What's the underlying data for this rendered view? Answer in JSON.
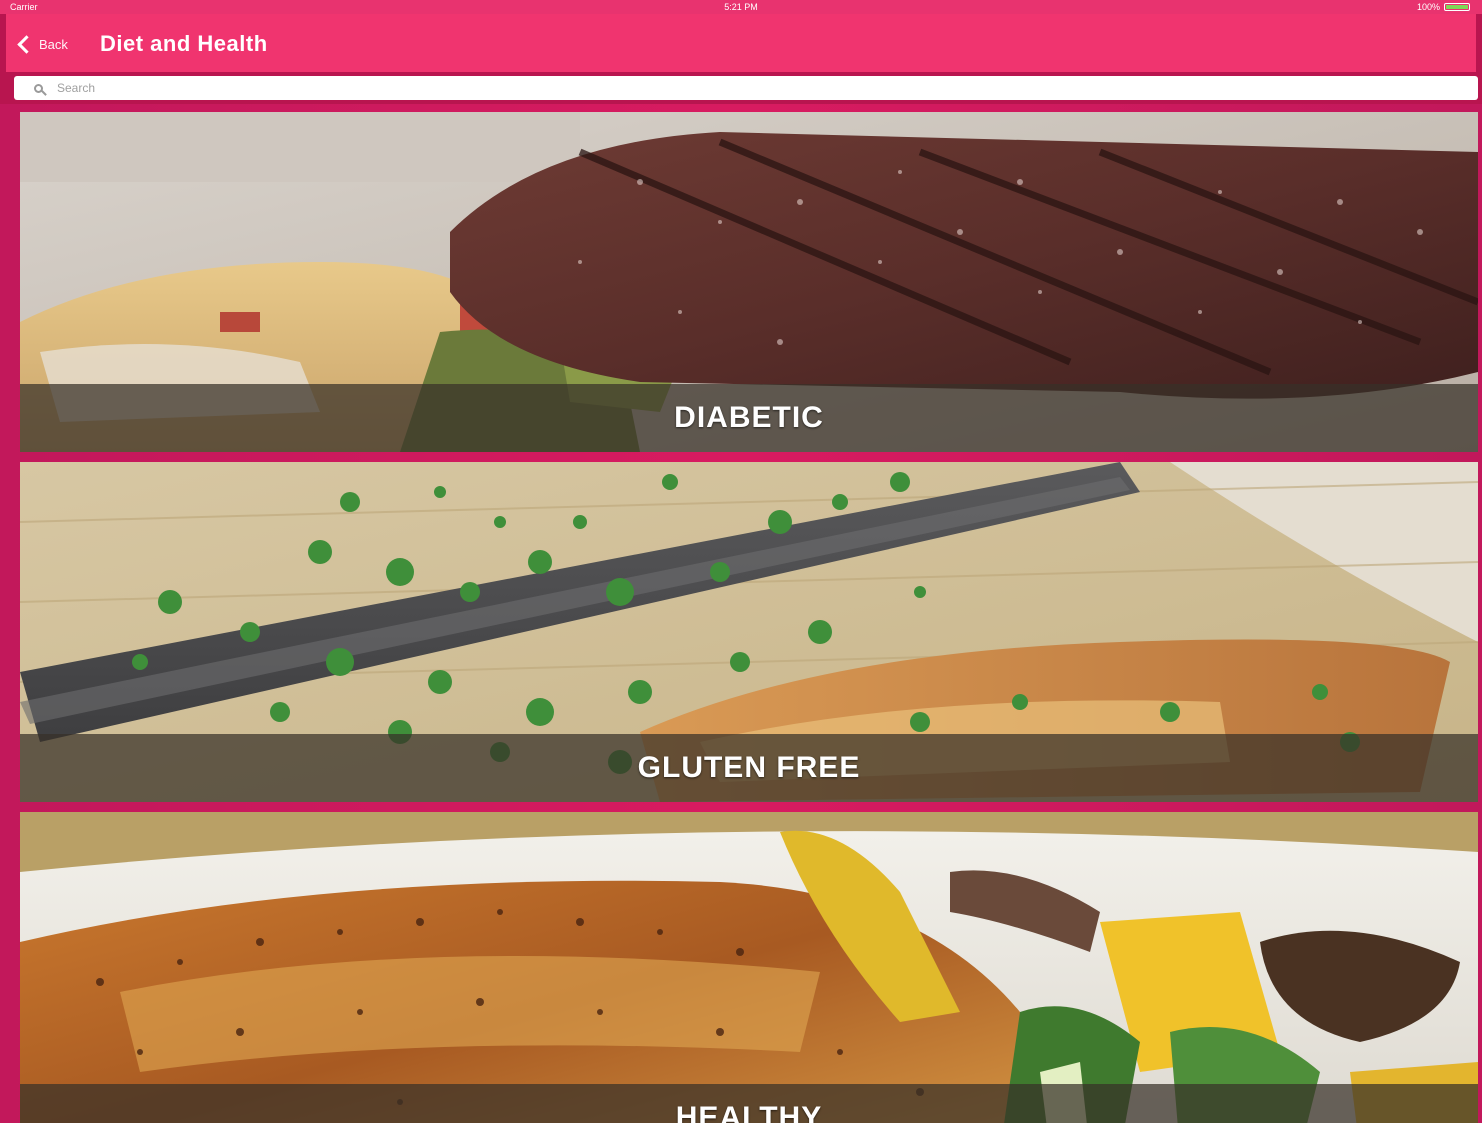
{
  "status_bar": {
    "carrier": "Carrier",
    "time": "5:21 PM",
    "battery": "100%"
  },
  "nav": {
    "back_label": "Back",
    "title": "Diet and Health"
  },
  "search": {
    "placeholder": "Search",
    "value": ""
  },
  "categories": [
    {
      "label": "DIABETIC",
      "photo": "grilled-steak-photo"
    },
    {
      "label": "GLUTEN FREE",
      "photo": "chopped-herbs-knife-photo"
    },
    {
      "label": "HEALTHY",
      "photo": "roasted-chicken-vegetables-photo"
    }
  ],
  "colors": {
    "nav_bar": "#f0346f",
    "background": "#c2185b",
    "caption_overlay": "#373028"
  }
}
